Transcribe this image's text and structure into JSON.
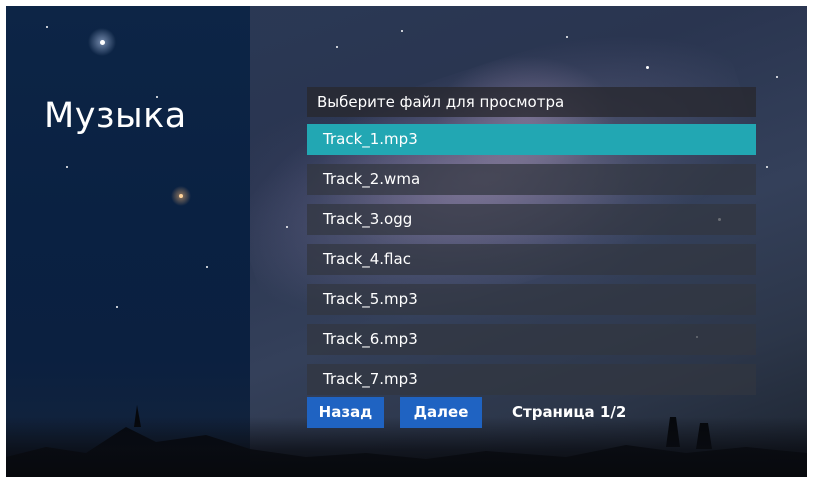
{
  "screen": {
    "title": "Музыка"
  },
  "file_browser": {
    "header": "Выберите файл для просмотра",
    "files": [
      {
        "name": "Track_1.mp3",
        "selected": true
      },
      {
        "name": "Track_2.wma",
        "selected": false
      },
      {
        "name": "Track_3.ogg",
        "selected": false
      },
      {
        "name": "Track_4.flac",
        "selected": false
      },
      {
        "name": "Track_5.mp3",
        "selected": false
      },
      {
        "name": "Track_6.mp3",
        "selected": false
      },
      {
        "name": "Track_7.mp3",
        "selected": false
      }
    ]
  },
  "navigation": {
    "back_label": "Назад",
    "next_label": "Далее",
    "page_label": "Страница 1/2"
  },
  "colors": {
    "selected_row": "#22a7b3",
    "button": "#1f63c2",
    "left_panel": "#0b2244"
  }
}
